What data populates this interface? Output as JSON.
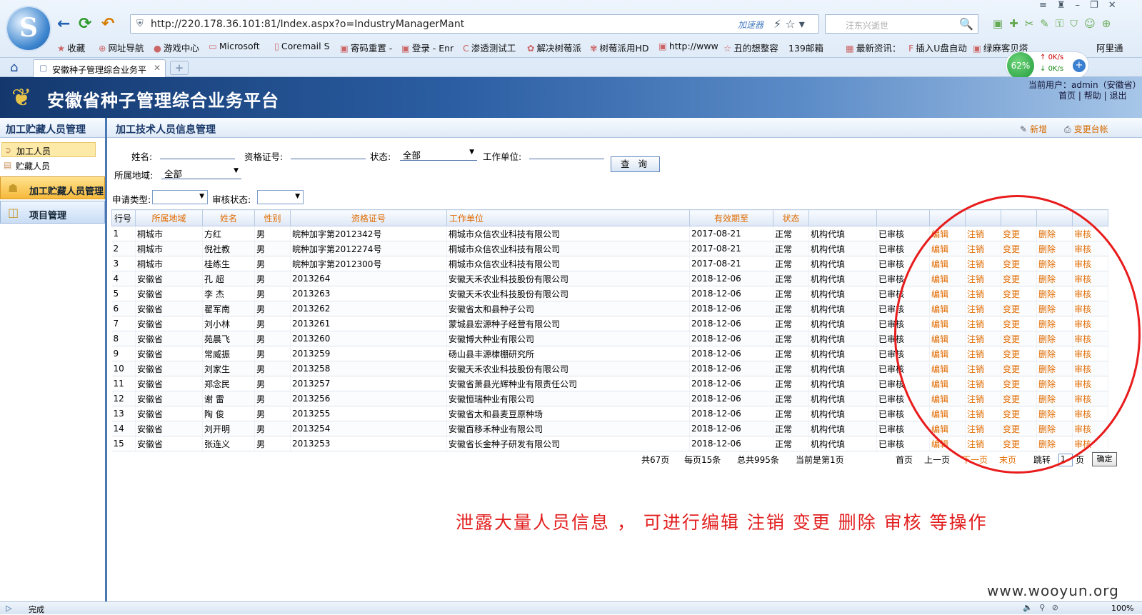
{
  "browser": {
    "url": "http://220.178.36.101:81/Index.aspx?o=IndustryManagerMant",
    "accelerator": "加速器",
    "search_placeholder": "汪东兴逝世",
    "logo_letter": "S",
    "bookmarks": [
      "收藏",
      "网址导航",
      "游戏中心",
      "Microsoft",
      "Coremail S",
      "寄码重置 -",
      "登录 - Enr",
      "渗透测试工",
      "解决树莓派",
      "树莓派用HD",
      "http://www",
      "丑的想整容",
      "139邮箱",
      "最新资讯：",
      "插入U盘自动",
      "绿麻客贝塔",
      "阿里通"
    ],
    "tab_title": "安徽种子管理综合业务平",
    "net_percent": "62%",
    "net_up": "0K/s",
    "net_down": "0K/s",
    "status_text": "完成",
    "zoom": "100%"
  },
  "header": {
    "title": "安徽省种子管理综合业务平台",
    "current_user": "当前用户：admin（安徽省）",
    "link_home": "首页",
    "link_help": "帮助",
    "link_exit": "退出",
    "sep": "|"
  },
  "sidebar": {
    "heading": "加工贮藏人员管理",
    "items": [
      "加工人员",
      "贮藏人员"
    ],
    "sections": [
      "加工贮藏人员管理",
      "项目管理"
    ]
  },
  "main": {
    "title": "加工技术人员信息管理",
    "action_new": "新增",
    "action_change": "变更台帐"
  },
  "filters": {
    "name_label": "姓名:",
    "cert_label": "资格证号:",
    "status_label": "状态:",
    "status_value": "全部",
    "unit_label": "工作单位:",
    "query_button": "查 询",
    "region_label": "所属地域:",
    "region_value": "全部",
    "apply_type_label": "申请类型:",
    "review_status_label": "审核状态:"
  },
  "table": {
    "headers": [
      "行号",
      "所属地域",
      "姓名",
      "性别",
      "资格证号",
      "工作单位",
      "有效期至",
      "状态",
      "",
      "",
      "",
      "",
      "",
      "",
      ""
    ],
    "rows": [
      [
        "1",
        "桐城市",
        "方红",
        "男",
        "皖种加字第2012342号",
        "桐城市众信农业科技有限公司",
        "2017-08-21",
        "正常",
        "机构代填",
        "已审核",
        "编辑",
        "注销",
        "变更",
        "删除",
        "审核"
      ],
      [
        "2",
        "桐城市",
        "倪社教",
        "男",
        "皖种加字第2012274号",
        "桐城市众信农业科技有限公司",
        "2017-08-21",
        "正常",
        "机构代填",
        "已审核",
        "编辑",
        "注销",
        "变更",
        "删除",
        "审核"
      ],
      [
        "3",
        "桐城市",
        "桂练生",
        "男",
        "皖种加字第2012300号",
        "桐城市众信农业科技有限公司",
        "2017-08-21",
        "正常",
        "机构代填",
        "已审核",
        "编辑",
        "注销",
        "变更",
        "删除",
        "审核"
      ],
      [
        "4",
        "安徽省",
        "孔  超",
        "男",
        "2013264",
        "安徽天禾农业科技股份有限公司",
        "2018-12-06",
        "正常",
        "机构代填",
        "已审核",
        "编辑",
        "注销",
        "变更",
        "删除",
        "审核"
      ],
      [
        "5",
        "安徽省",
        "李  杰",
        "男",
        "2013263",
        "安徽天禾农业科技股份有限公司",
        "2018-12-06",
        "正常",
        "机构代填",
        "已审核",
        "编辑",
        "注销",
        "变更",
        "删除",
        "审核"
      ],
      [
        "6",
        "安徽省",
        "翟军南",
        "男",
        "2013262",
        "安徽省太和县种子公司",
        "2018-12-06",
        "正常",
        "机构代填",
        "已审核",
        "编辑",
        "注销",
        "变更",
        "删除",
        "审核"
      ],
      [
        "7",
        "安徽省",
        "刘小林",
        "男",
        "2013261",
        "蒙城县宏源种子经营有限公司",
        "2018-12-06",
        "正常",
        "机构代填",
        "已审核",
        "编辑",
        "注销",
        "变更",
        "删除",
        "审核"
      ],
      [
        "8",
        "安徽省",
        "苑晨飞",
        "男",
        "2013260",
        "安徽博大种业有限公司",
        "2018-12-06",
        "正常",
        "机构代填",
        "已审核",
        "编辑",
        "注销",
        "变更",
        "删除",
        "审核"
      ],
      [
        "9",
        "安徽省",
        "常威振",
        "男",
        "2013259",
        "砀山县丰源棣棚研究所",
        "2018-12-06",
        "正常",
        "机构代填",
        "已审核",
        "编辑",
        "注销",
        "变更",
        "删除",
        "审核"
      ],
      [
        "10",
        "安徽省",
        "刘家生",
        "男",
        "2013258",
        "安徽天禾农业科技股份有限公司",
        "2018-12-06",
        "正常",
        "机构代填",
        "已审核",
        "编辑",
        "注销",
        "变更",
        "删除",
        "审核"
      ],
      [
        "11",
        "安徽省",
        "郑念民",
        "男",
        "2013257",
        "安徽省萧县光辉种业有限责任公司",
        "2018-12-06",
        "正常",
        "机构代填",
        "已审核",
        "编辑",
        "注销",
        "变更",
        "删除",
        "审核"
      ],
      [
        "12",
        "安徽省",
        "谢  雷",
        "男",
        "2013256",
        "安徽恒瑞种业有限公司",
        "2018-12-06",
        "正常",
        "机构代填",
        "已审核",
        "编辑",
        "注销",
        "变更",
        "删除",
        "审核"
      ],
      [
        "13",
        "安徽省",
        "陶  俊",
        "男",
        "2013255",
        "安徽省太和县麦豆原种场",
        "2018-12-06",
        "正常",
        "机构代填",
        "已审核",
        "编辑",
        "注销",
        "变更",
        "删除",
        "审核"
      ],
      [
        "14",
        "安徽省",
        "刘开明",
        "男",
        "2013254",
        "安徽百移禾种业有限公司",
        "2018-12-06",
        "正常",
        "机构代填",
        "已审核",
        "编辑",
        "注销",
        "变更",
        "删除",
        "审核"
      ],
      [
        "15",
        "安徽省",
        "张连义",
        "男",
        "2013253",
        "安徽省长金种子研发有限公司",
        "2018-12-06",
        "正常",
        "机构代填",
        "已审核",
        "编辑",
        "注销",
        "变更",
        "删除",
        "审核"
      ]
    ]
  },
  "pager": {
    "total_pages": "共67页",
    "per_page": "每页15条",
    "total_records": "总共995条",
    "current": "当前是第1页",
    "first": "首页",
    "prev": "上一页",
    "next": "下一页",
    "last": "末页",
    "jump": "跳转",
    "jump_value": "1",
    "page_unit": "页",
    "ok": "确定"
  },
  "annotation": "泄露大量人员信息 ， 可进行编辑 注销 变更 删除 审核 等操作",
  "watermark": "www.wooyun.org",
  "colors": {
    "accent": "#e06b00",
    "banner": "#1e4a86",
    "annotation": "#e21f1f"
  }
}
